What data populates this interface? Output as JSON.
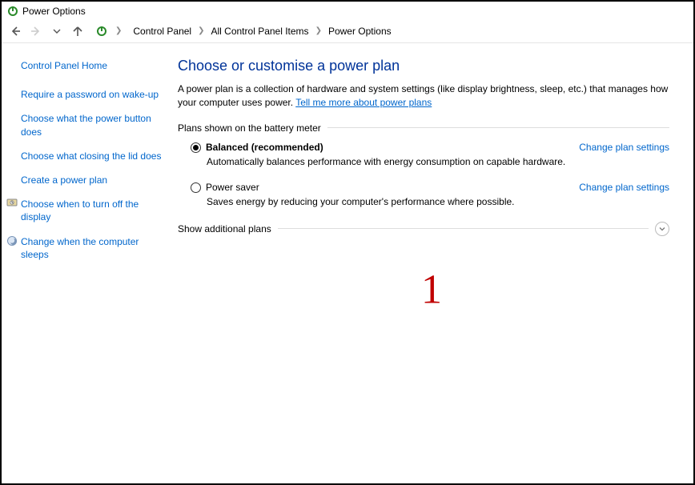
{
  "window": {
    "title": "Power Options"
  },
  "breadcrumb": {
    "items": [
      "Control Panel",
      "All Control Panel Items",
      "Power Options"
    ]
  },
  "sidebar": {
    "home": "Control Panel Home",
    "links": [
      "Require a password on wake-up",
      "Choose what the power button does",
      "Choose what closing the lid does",
      "Create a power plan",
      "Choose when to turn off the display",
      "Change when the computer sleeps"
    ]
  },
  "main": {
    "heading": "Choose or customise a power plan",
    "description": "A power plan is a collection of hardware and system settings (like display brightness, sleep, etc.) that manages how your computer uses power. ",
    "desc_link": "Tell me more about power plans",
    "section_label": "Plans shown on the battery meter",
    "plans": [
      {
        "name": "Balanced (recommended)",
        "desc": "Automatically balances performance with energy consumption on capable hardware.",
        "change": "Change plan settings",
        "selected": true
      },
      {
        "name": "Power saver",
        "desc": "Saves energy by reducing your computer's performance where possible.",
        "change": "Change plan settings",
        "selected": false
      }
    ],
    "expand_label": "Show additional plans"
  },
  "annotation": "1"
}
